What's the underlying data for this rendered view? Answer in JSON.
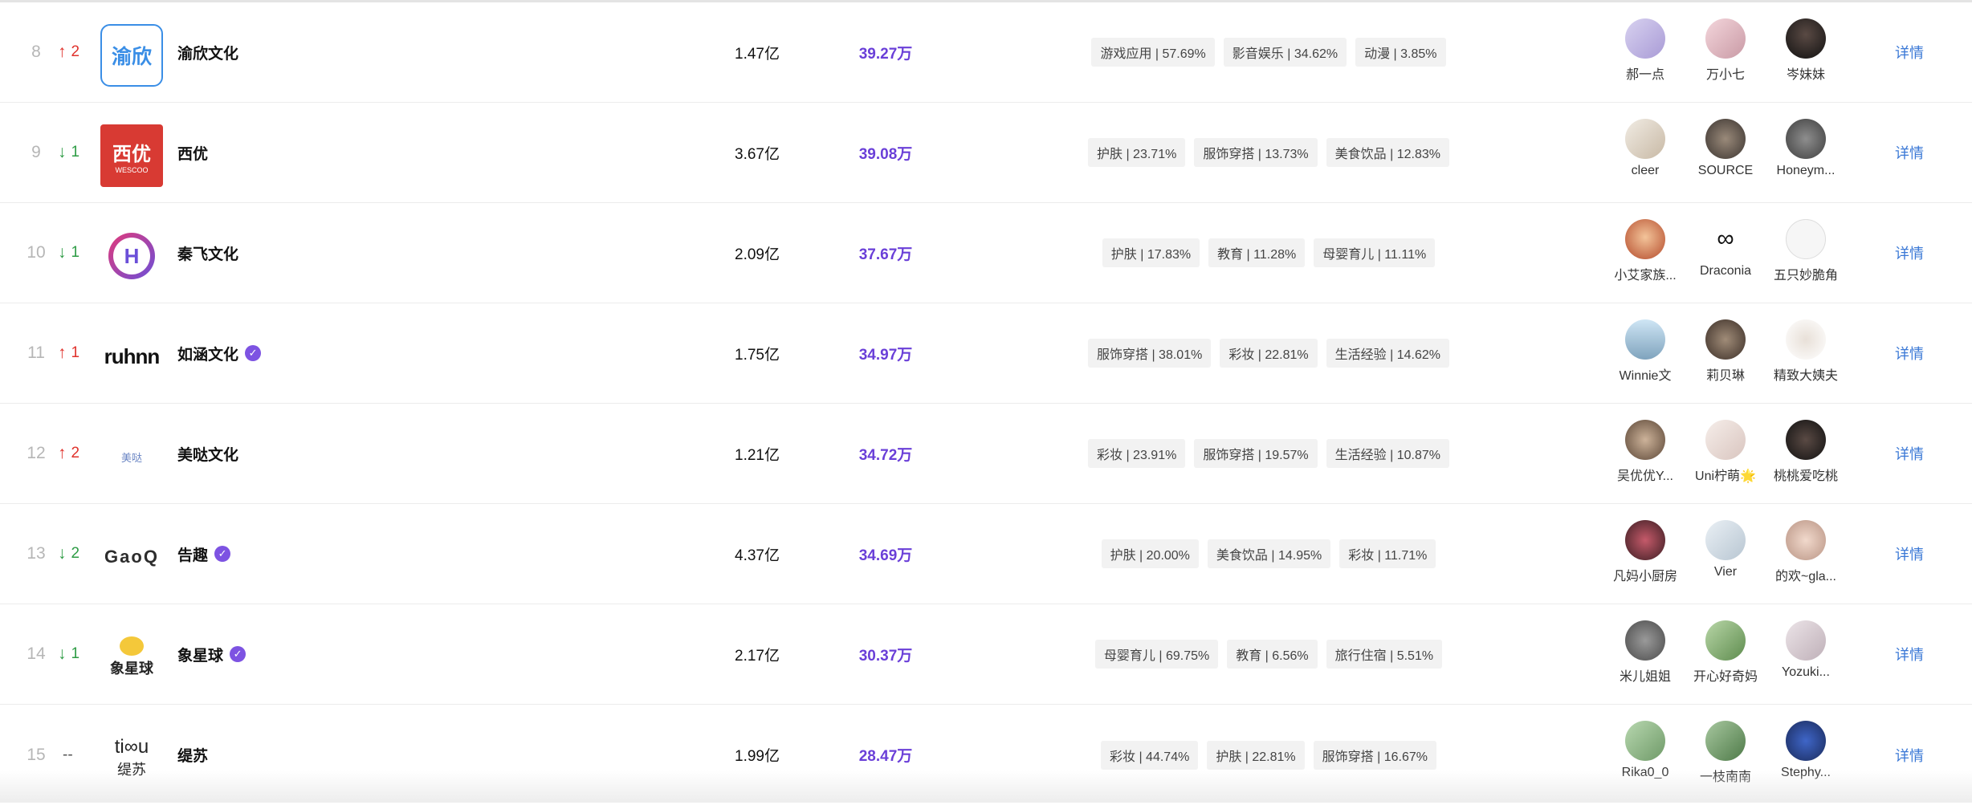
{
  "rows": [
    {
      "rank": "8",
      "change_dir": "up",
      "change_arrow": "↑",
      "change_value": "2",
      "logo_text": "渝欣",
      "name": "渝欣文化",
      "verified": false,
      "fans": "1.47亿",
      "interaction": "39.27万",
      "tags": [
        "游戏应用 | 57.69%",
        "影音娱乐 | 34.62%",
        "动漫 | 3.85%"
      ],
      "kols": [
        "郝一点",
        "万小七",
        "岑妹妹"
      ],
      "detail": "详情"
    },
    {
      "rank": "9",
      "change_dir": "down",
      "change_arrow": "↓",
      "change_value": "1",
      "logo_text": "西优",
      "logo_sub": "WESCOO",
      "name": "西优",
      "verified": false,
      "fans": "3.67亿",
      "interaction": "39.08万",
      "tags": [
        "护肤 | 23.71%",
        "服饰穿搭 | 13.73%",
        "美食饮品 | 12.83%"
      ],
      "kols": [
        "cleer",
        "SOURCE",
        "Honeym..."
      ],
      "detail": "详情"
    },
    {
      "rank": "10",
      "change_dir": "down",
      "change_arrow": "↓",
      "change_value": "1",
      "logo_text": "H",
      "name": "秦飞文化",
      "verified": false,
      "fans": "2.09亿",
      "interaction": "37.67万",
      "tags": [
        "护肤 | 17.83%",
        "教育 | 11.28%",
        "母婴育儿 | 11.11%"
      ],
      "kols": [
        "小艾家族...",
        "Draconia",
        "五只妙脆角"
      ],
      "detail": "详情"
    },
    {
      "rank": "11",
      "change_dir": "up",
      "change_arrow": "↑",
      "change_value": "1",
      "logo_text": "ruhnn",
      "name": "如涵文化",
      "verified": true,
      "fans": "1.75亿",
      "interaction": "34.97万",
      "tags": [
        "服饰穿搭 | 38.01%",
        "彩妆 | 22.81%",
        "生活经验 | 14.62%"
      ],
      "kols": [
        "Winnie文",
        "莉贝琳",
        "精致大姨夫"
      ],
      "detail": "详情"
    },
    {
      "rank": "12",
      "change_dir": "up",
      "change_arrow": "↑",
      "change_value": "2",
      "logo_text": "美哒",
      "name": "美哒文化",
      "verified": false,
      "fans": "1.21亿",
      "interaction": "34.72万",
      "tags": [
        "彩妆 | 23.91%",
        "服饰穿搭 | 19.57%",
        "生活经验 | 10.87%"
      ],
      "kols": [
        "吴优优Y...",
        "Uni柠萌🌟",
        "桃桃爱吃桃"
      ],
      "detail": "详情"
    },
    {
      "rank": "13",
      "change_dir": "down",
      "change_arrow": "↓",
      "change_value": "2",
      "logo_text": "GaoQ",
      "name": "告趣",
      "verified": true,
      "fans": "4.37亿",
      "interaction": "34.69万",
      "tags": [
        "护肤 | 20.00%",
        "美食饮品 | 14.95%",
        "彩妆 | 11.71%"
      ],
      "kols": [
        "凡妈小厨房",
        "Vier",
        "的欢~gla..."
      ],
      "detail": "详情"
    },
    {
      "rank": "14",
      "change_dir": "down",
      "change_arrow": "↓",
      "change_value": "1",
      "logo_text": "象星球",
      "name": "象星球",
      "verified": true,
      "fans": "2.17亿",
      "interaction": "30.37万",
      "tags": [
        "母婴育儿 | 69.75%",
        "教育 | 6.56%",
        "旅行住宿 | 5.51%"
      ],
      "kols": [
        "米儿姐姐",
        "开心好奇妈",
        "Yozuki..."
      ],
      "detail": "详情"
    },
    {
      "rank": "15",
      "change_dir": "flat",
      "change_arrow": "",
      "change_value": "--",
      "logo_text": "ti∞u",
      "logo_sub": "缇苏",
      "name": "缇苏",
      "verified": false,
      "fans": "1.99亿",
      "interaction": "28.47万",
      "tags": [
        "彩妆 | 44.74%",
        "护肤 | 22.81%",
        "服饰穿搭 | 16.67%"
      ],
      "kols": [
        "Rika0_0",
        "一枝南南",
        "Stephy..."
      ],
      "detail": "详情"
    }
  ],
  "colors": {
    "up": "#e0322c",
    "down": "#2e9c45",
    "interaction": "#6a3fd8",
    "detail": "#3a78d6",
    "verified": "#7d53e2",
    "tag_bg": "#f2f2f2"
  }
}
